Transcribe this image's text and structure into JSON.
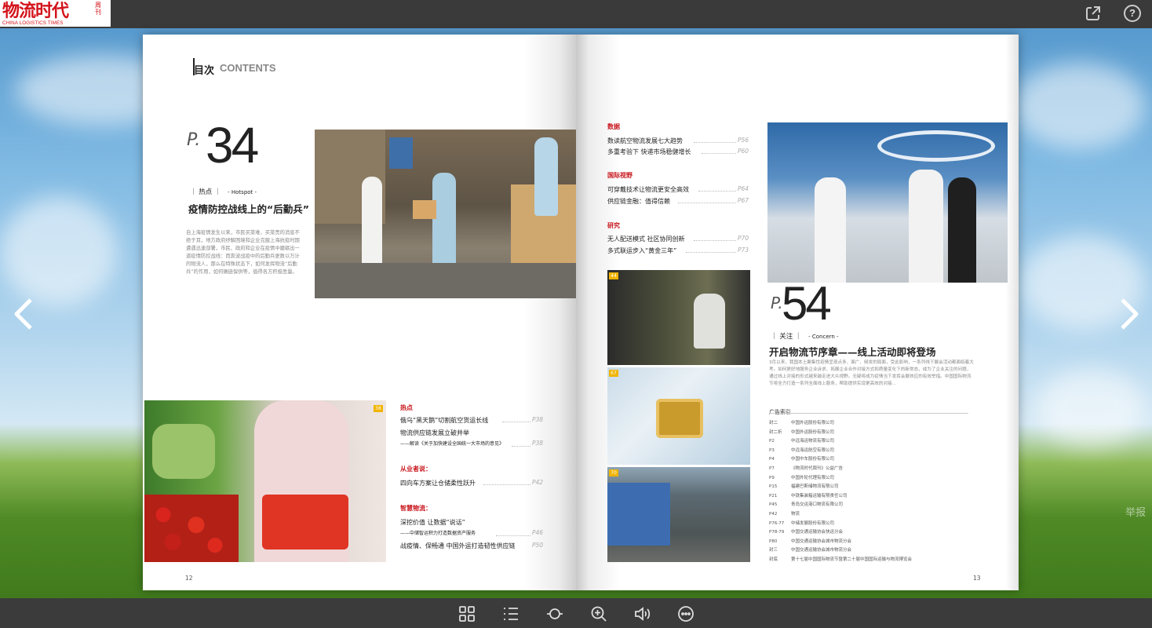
{
  "brand": {
    "logo_title": "物流时代",
    "logo_weekly": "周刊",
    "logo_sub": "CHINA LOGISTICS TIMES"
  },
  "toolbar": {
    "share_icon": "share-icon",
    "help_icon": "help-icon",
    "help_label": "?"
  },
  "left_page": {
    "heading_cn": "目次",
    "heading_en": "CONTENTS",
    "feature": {
      "p": "P.",
      "num": "34",
      "tag_cn": "热点",
      "tag_en": "- Hotspot -",
      "title": "疫情防控战线上的“后勤兵”",
      "summary": "自上海疫情发生以来，市民买菜难、买菜贵的消息不绝于耳，地方政府纾解困境和企业克服上海抗疫时期遭遇迅速部署，市民、政府和企业在疫情中磨砺出一道疫情防控战线：而奔波战疫中的后勤兵更数以万计的物流人，那么在特殊状态下，如何发挥物流“后勤兵”的作用，如何确链保供等，值得各方积极思量。"
    },
    "photo_badge": "38",
    "sections": [
      {
        "label": "热点",
        "items": [
          {
            "text": "俄乌“黑天鹅”切割航空货运长线",
            "page": "P38"
          },
          {
            "text": "物流供应链发展立破并举",
            "page": ""
          },
          {
            "text": "——解读《关于加快建设全国统一大市场的意见》",
            "page": "P38",
            "sub": true
          }
        ]
      },
      {
        "label": "从业者说：",
        "items": [
          {
            "text": "四向车方案让仓储柔性跃升",
            "page": "P42"
          }
        ]
      },
      {
        "label": "智慧物流：",
        "items": [
          {
            "text": "深挖价值 让数据“说话”",
            "page": ""
          },
          {
            "text": "——中储智运积力打造数据资产服务",
            "page": "P46",
            "sub": true
          },
          {
            "text": "战疫情、保畅通 中国外运打造韧性供应链",
            "page": "P50"
          }
        ]
      }
    ],
    "page_number": "12"
  },
  "right_page": {
    "sections": [
      {
        "label": "数据",
        "items": [
          {
            "text": "数读航空物流发展七大趋势",
            "page": "P56"
          },
          {
            "text": "多重考验下 快递市场稳健增长",
            "page": "P60"
          }
        ]
      },
      {
        "label": "国际视野",
        "items": [
          {
            "text": "可穿戴技术让物流更安全高效",
            "page": "P64"
          },
          {
            "text": "供应链金融：值得信赖",
            "page": "P67"
          }
        ]
      },
      {
        "label": "研究",
        "items": [
          {
            "text": "无人配送模式 社区协同创新",
            "page": "P70"
          },
          {
            "text": "多式联运步入“黄金三年”",
            "page": "P73"
          }
        ]
      }
    ],
    "thumb_badges": [
      "44",
      "67",
      "70"
    ],
    "feature": {
      "p": "P.",
      "num": "54",
      "tag_cn": "关注",
      "tag_en": "- Concern -",
      "title": "开启物流节序章——线上活动即将登场",
      "summary": "3月以来，我国本土聚集性疫情呈现点多、面广、频发的局面，受此影响，一系列线下展会活动都面临着大考。如何更好地服务企业诉求、拓展企业合作对接方式和质量变化下的新常态，成为了企业关注的问题，通过线上对接的形式越来越走进大众视野。无疑将成为疫情当下发挥会展效应的有效举措。中国国际物流节将全力打造一系列全面线上服务，帮助提供实现更高效的对接…"
    },
    "ads_title": "广告索引",
    "ads": [
      [
        "封二",
        "中国外运股份有限公司"
      ],
      [
        "封二折",
        "中国外运股份有限公司"
      ],
      [
        "P2",
        "中远海运物流有限公司"
      ],
      [
        "P3",
        "中远海运航空有限公司"
      ],
      [
        "P4",
        "中国中车股份有限公司"
      ],
      [
        "P7",
        "《物流时代周刊》公益广告"
      ],
      [
        "P9",
        "中国外轮代理有限公司"
      ],
      [
        "P15",
        "福建巴斯储物流有限公司"
      ],
      [
        "P21",
        "中铁集装箱运输有限责任公司"
      ],
      [
        "P45",
        "青岛交运港口物流有限公司"
      ],
      [
        "P42",
        "物流"
      ],
      [
        "P76-77",
        "中储发展股份有限公司"
      ],
      [
        "P78-79",
        "中国交通运输协会快运分会"
      ],
      [
        "P80",
        "中国交通运输协会城市物流分会"
      ],
      [
        "封三",
        "中国交通运输协会城市物流分会"
      ],
      [
        "封底",
        "第十七届中国国际物流节暨第二十届中国国际运输与物流博览会"
      ]
    ],
    "page_number": "13"
  },
  "watermark": "举报",
  "bottom_icons": [
    "grid-view-icon",
    "list-view-icon",
    "autoplay-icon",
    "zoom-in-icon",
    "sound-icon",
    "more-icon"
  ]
}
